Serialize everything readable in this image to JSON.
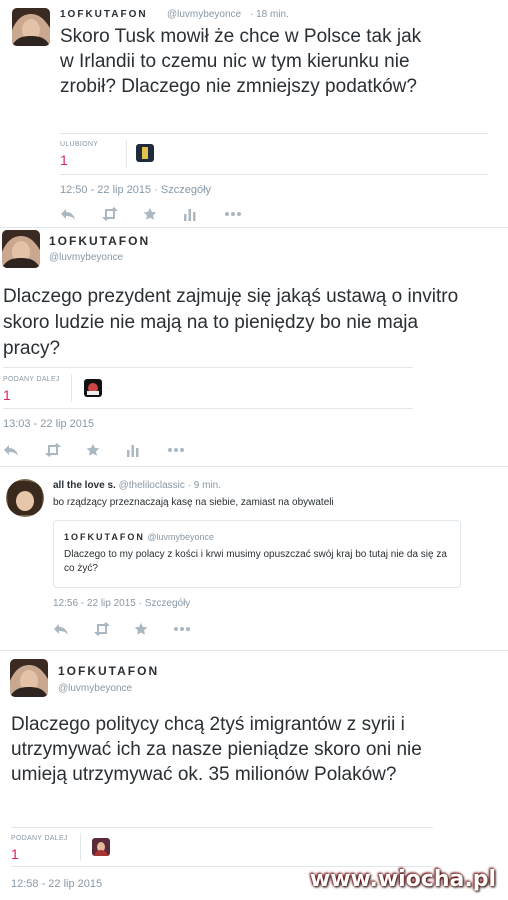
{
  "tweet1": {
    "name": "1OFKUTAFON",
    "handle": "@luvmybeyonce",
    "time": "· 18 min.",
    "text": "Skoro Tusk mowił że chce w Polsce tak jak w Irlandii to czemu nic w tym kierunku nie zrobił? Dlaczego nie zmniejszy podatków?",
    "stat_label": "ULUBIONY",
    "stat_count": "1",
    "timestamp": "12:50 - 22 lip 2015",
    "details_link": "· Szczegóły"
  },
  "tweet2": {
    "name": "1OFKUTAFON",
    "handle": "@luvmybeyonce",
    "text": "Dlaczego prezydent zajmuję się jakąś ustawą o invitro skoro ludzie nie mają na to pieniędzy bo nie maja pracy?",
    "stat_label": "PODANY DALEJ",
    "stat_count": "1",
    "timestamp": "13:03 - 22 lip 2015"
  },
  "tweet3": {
    "name": "all the love s.",
    "handle": "@theliloclassic",
    "time": "· 9 min.",
    "text": "bo rządzący przeznaczają kasę na siebie, zamiast na obywateli",
    "quote": {
      "name": "1OFKUTAFON",
      "handle": "@luvmybeyonce",
      "text": "Dlaczego to my polacy z kości i krwi musimy opuszczać swój kraj bo tutaj nie da się za co żyć?"
    },
    "timestamp": "12:56 - 22 lip 2015",
    "details_link": "· Szczegóły"
  },
  "tweet4": {
    "name": "1OFKUTAFON",
    "handle": "@luvmybeyonce",
    "text": "Dlaczego politycy chcą 2tyś imigrantów z syrii i utrzymywać ich za nasze pieniądze skoro oni nie umieją utrzymywać ok. 35 milionów Polaków?",
    "stat_label": "PODANY DALEJ",
    "stat_count": "1",
    "timestamp": "12:58 - 22 lip 2015"
  },
  "watermark": "www.wiocha.pl",
  "colors": {
    "text": "#292f33",
    "muted": "#8899a6",
    "action_icons": "#aab8c2",
    "count": "#e0245e",
    "divider": "#e1e8ed"
  },
  "icons": [
    "reply-icon",
    "retweet-icon",
    "favorite-star-icon",
    "analytics-icon",
    "more-dots-icon"
  ]
}
